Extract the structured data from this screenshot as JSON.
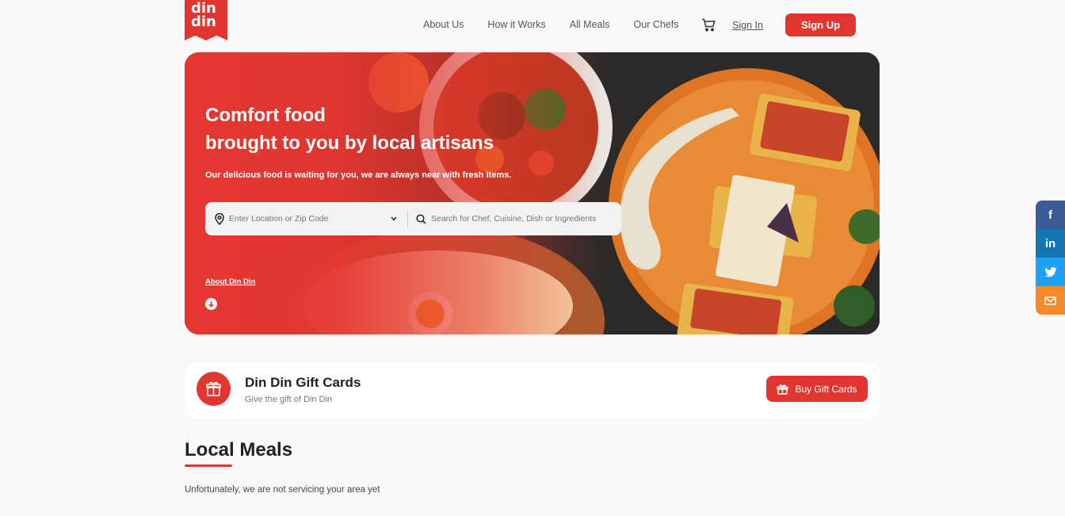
{
  "brand": {
    "logo_line1": "din",
    "logo_line2": "din"
  },
  "nav": {
    "items": [
      "About Us",
      "How it Works",
      "All Meals",
      "Our Chefs"
    ],
    "signin": "Sign In",
    "signup": "Sign Up"
  },
  "hero": {
    "title_line1": "Comfort food",
    "title_line2": "brought to you by local artisans",
    "subtitle": "Our delicious food is waiting for you, we are always near with fresh items.",
    "location_placeholder": "Enter Location or Zip Code",
    "search_placeholder": "Search for Chef, Cuisine, Dish or Ingredients",
    "about_link": "About Din Din"
  },
  "gift": {
    "title": "Din Din Gift Cards",
    "subtitle": "Give the gift of Din Din",
    "button": "Buy Gift Cards"
  },
  "local": {
    "heading": "Local Meals",
    "notice": "Unfortunately, we are not servicing your area yet"
  },
  "social": {
    "facebook": "f",
    "linkedin": "in",
    "twitter": "twitter-icon",
    "email": "mail-icon"
  },
  "colors": {
    "accent": "#e0362f",
    "background": "#f9f9f9",
    "facebook": "#3a5a98",
    "linkedin": "#1176b2",
    "twitter": "#1da1f2",
    "email": "#f58a2b"
  }
}
